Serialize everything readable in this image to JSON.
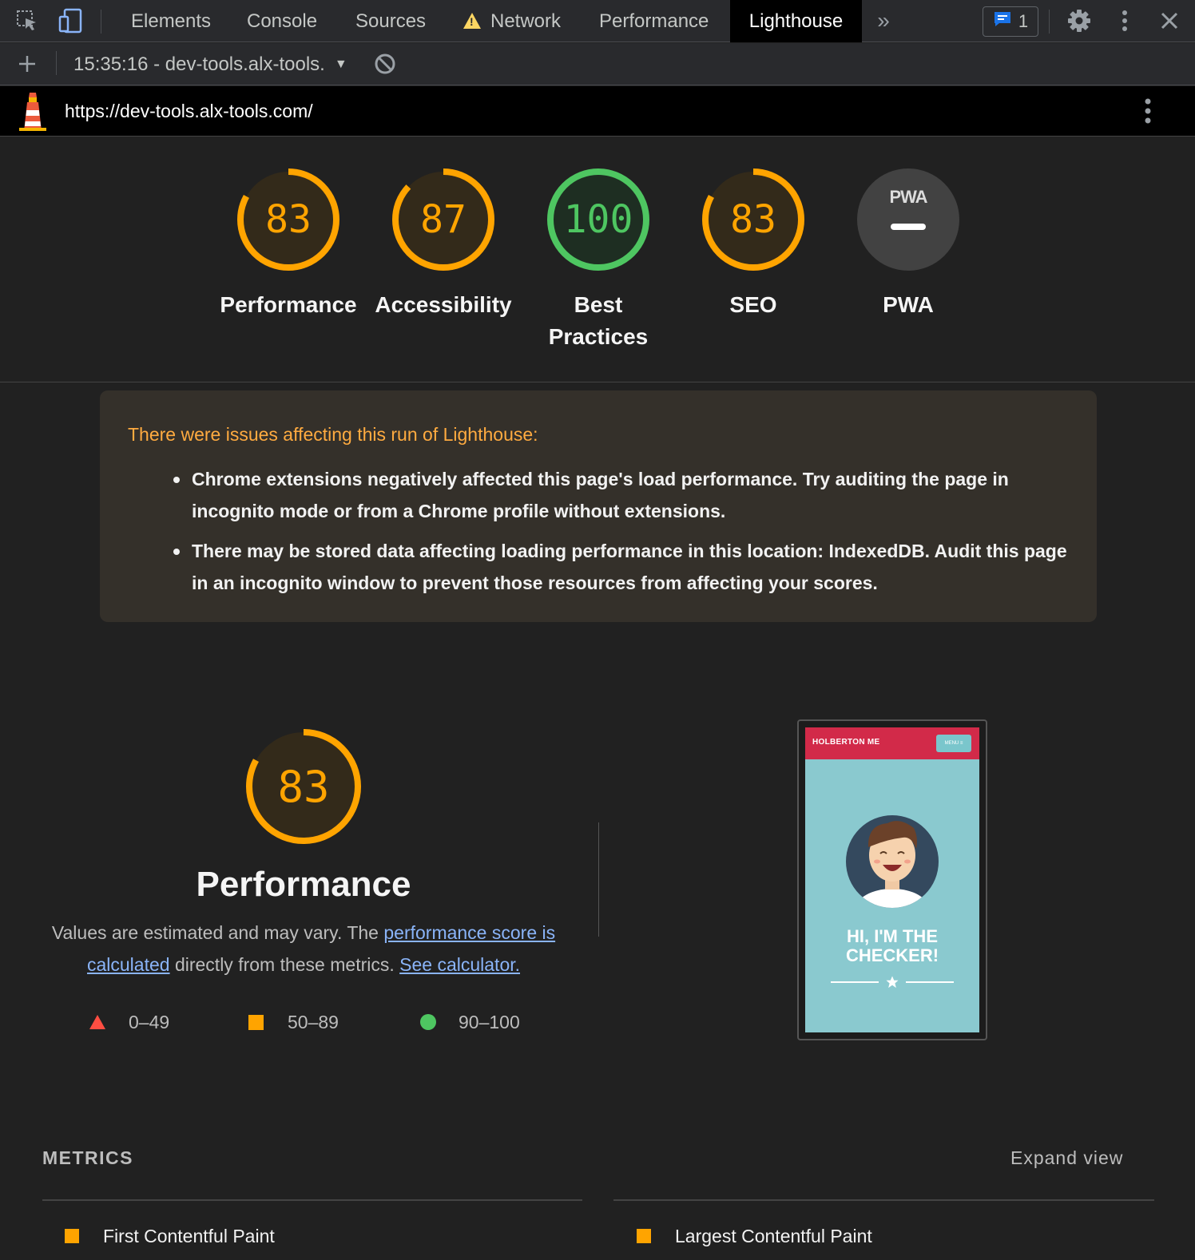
{
  "devtools": {
    "tabs": [
      {
        "label": "Elements"
      },
      {
        "label": "Console"
      },
      {
        "label": "Sources"
      },
      {
        "label": "Network",
        "warning": true
      },
      {
        "label": "Performance"
      },
      {
        "label": "Lighthouse",
        "active": true
      }
    ],
    "issues_count": "1",
    "report_selector": "15:35:16 - dev-tools.alx-tools."
  },
  "lighthouse": {
    "url": "https://dev-tools.alx-tools.com/",
    "categories": [
      {
        "label": "Performance",
        "score": "83",
        "value": 0.83,
        "color": "#ffa400"
      },
      {
        "label": "Accessibility",
        "score": "87",
        "value": 0.87,
        "color": "#ffa400"
      },
      {
        "label": "Best Practices",
        "score": "100",
        "value": 1.0,
        "color": "#4ec661"
      },
      {
        "label": "SEO",
        "score": "83",
        "value": 0.83,
        "color": "#ffa400"
      },
      {
        "label": "PWA",
        "badge": "PWA"
      }
    ],
    "warnings": {
      "title": "There were issues affecting this run of Lighthouse:",
      "items": [
        "Chrome extensions negatively affected this page's load performance. Try auditing the page in incognito mode or from a Chrome profile without extensions.",
        "There may be stored data affecting loading performance in this location: IndexedDB. Audit this page in an incognito window to prevent those resources from affecting your scores."
      ]
    },
    "performance": {
      "score": "83",
      "value": 0.83,
      "title": "Performance",
      "desc_prefix": "Values are estimated and may vary. The ",
      "desc_link1": "performance score is calculated",
      "desc_middle": " directly from these metrics. ",
      "desc_link2": "See calculator.",
      "scale": [
        {
          "label": "0–49",
          "color": "#ff4e42"
        },
        {
          "label": "50–89",
          "color": "#ffa400"
        },
        {
          "label": "90–100",
          "color": "#4ec661"
        }
      ]
    },
    "screenshot": {
      "brand": "HOLBERTON ME",
      "menu": "MENU ≡",
      "headline": "HI, I'M THE CHECKER!"
    },
    "metrics": {
      "heading": "METRICS",
      "expand_label": "Expand view",
      "items": [
        "First Contentful Paint",
        "Largest Contentful Paint"
      ]
    }
  },
  "colors": {
    "average": "#ffa400",
    "pass": "#4ec661",
    "fail": "#ff4e42"
  }
}
